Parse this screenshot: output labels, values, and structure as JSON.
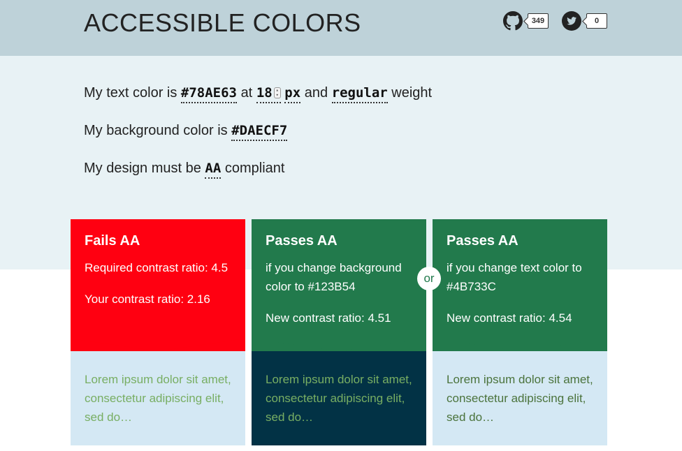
{
  "header": {
    "title": "ACCESSIBLE COLORS",
    "github": {
      "icon": "github-icon",
      "count": "349"
    },
    "twitter": {
      "icon": "twitter-icon",
      "count": "0"
    }
  },
  "form": {
    "line1": {
      "prefix": "My text color is",
      "text_color": "#78AE63",
      "at": "at",
      "size": "18",
      "unit": "px",
      "and": "and",
      "weight": "regular",
      "suffix": "weight"
    },
    "line2": {
      "prefix": "My background color is",
      "bg_color": "#DAECF7"
    },
    "line3": {
      "prefix": "My design must be",
      "level": "AA",
      "suffix": "compliant"
    }
  },
  "cards": [
    {
      "title": "Fails AA",
      "lines": [
        "Required contrast ratio: 4.5",
        "Your contrast ratio: 2.16"
      ],
      "sample": "Lorem ipsum dolor sit amet, consectetur adipiscing elit, sed do…",
      "top_color": "#FF0011",
      "sample_bg": "#D4E8F4",
      "sample_text_color": "#78AE63"
    },
    {
      "title": "Passes AA",
      "lines": [
        "if you change background color to #123B54",
        "New contrast ratio: 4.51"
      ],
      "sample": "Lorem ipsum dolor sit amet, consectetur adipiscing elit, sed do…",
      "top_color": "#227A4C",
      "sample_bg": "#023245",
      "sample_text_color": "#78AE63"
    },
    {
      "title": "Passes AA",
      "lines": [
        "if you change text color to #4B733C",
        "New contrast ratio: 4.54"
      ],
      "sample": "Lorem ipsum dolor sit amet, consectetur adipiscing elit, sed do…",
      "top_color": "#227A4C",
      "sample_bg": "#D4E8F4",
      "sample_text_color": "#4B733C"
    }
  ],
  "or_label": "or",
  "colors": {
    "header_bg": "#BED2D9",
    "form_bg": "#E8F2F5"
  }
}
